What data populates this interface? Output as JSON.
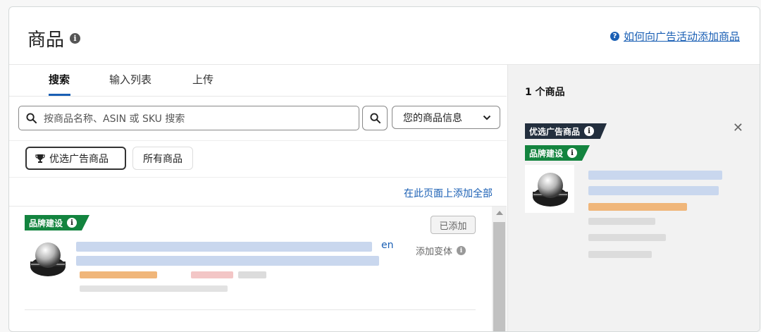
{
  "header": {
    "title": "商品",
    "help_link": "如何向广告活动添加商品"
  },
  "tabs": [
    {
      "label": "搜索"
    },
    {
      "label": "输入列表"
    },
    {
      "label": "上传"
    }
  ],
  "search": {
    "placeholder": "按商品名称、ASIN 或 SKU 搜索",
    "dropdown_label": "您的商品信息"
  },
  "filters": {
    "featured_label": "优选广告商品",
    "all_label": "所有商品"
  },
  "list": {
    "add_all_label": "在此页面上添加全部",
    "items": [
      {
        "badge": "品牌建设",
        "title_tail": "en",
        "status_button": "已添加",
        "variant_label": "添加变体"
      }
    ]
  },
  "right_panel": {
    "title": "1 个商品",
    "badges": {
      "featured": "优选广告商品",
      "brand": "品牌建设"
    }
  },
  "colors": {
    "accent": "#1a5fb4",
    "badge_green": "#13843f",
    "badge_dark": "#232f3e"
  },
  "icons": [
    "info-icon",
    "help-circle-icon",
    "search-icon",
    "chevron-down-icon",
    "trophy-icon",
    "close-icon"
  ]
}
